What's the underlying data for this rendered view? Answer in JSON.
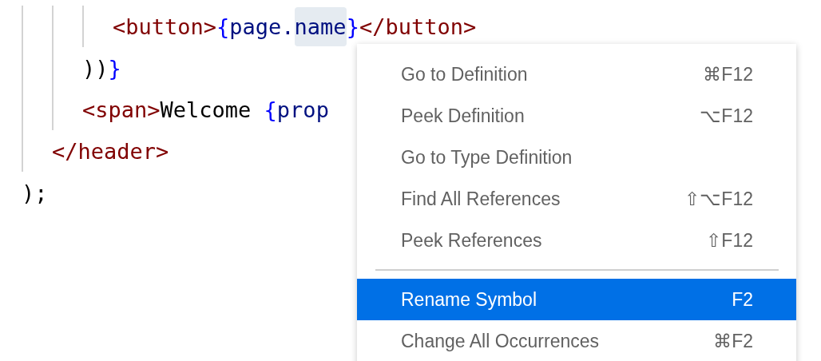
{
  "code": {
    "lines": [
      {
        "children": [
          {
            "children": [
              {
                "children": [
                  {
                    "tokens": [
                      {
                        "kind": "tag",
                        "text": "<button>"
                      },
                      {
                        "kind": "brace",
                        "text": "{"
                      },
                      {
                        "kind": "ident",
                        "text": "page."
                      },
                      {
                        "kind": "ident",
                        "text": "name",
                        "highlighted": true
                      },
                      {
                        "kind": "brace",
                        "text": "}"
                      },
                      {
                        "kind": "tag",
                        "text": "</button>"
                      }
                    ]
                  }
                ]
              },
              {
                "tokens": [
                  {
                    "kind": "plain",
                    "text": "))"
                  },
                  {
                    "kind": "brace",
                    "text": "}"
                  }
                ]
              },
              {
                "tokens": [
                  {
                    "kind": "tag",
                    "text": "<span>"
                  },
                  {
                    "kind": "plain",
                    "text": "Welcome "
                  },
                  {
                    "kind": "brace",
                    "text": "{"
                  },
                  {
                    "kind": "ident",
                    "text": "prop"
                  }
                ]
              }
            ]
          },
          {
            "tokens": [
              {
                "kind": "tag",
                "text": "</header>"
              }
            ]
          }
        ]
      },
      {
        "tokens": [
          {
            "kind": "plain",
            "text": ");"
          }
        ]
      }
    ]
  },
  "context_menu": {
    "items": [
      {
        "kind": "item",
        "label": "Go to Definition",
        "shortcut": "⌘F12",
        "selected": false
      },
      {
        "kind": "item",
        "label": "Peek Definition",
        "shortcut": "⌥F12",
        "selected": false
      },
      {
        "kind": "item",
        "label": "Go to Type Definition",
        "selected": false
      },
      {
        "kind": "item",
        "label": "Find All References",
        "shortcut": "⇧⌥F12",
        "selected": false
      },
      {
        "kind": "item",
        "label": "Peek References",
        "shortcut": "⇧F12",
        "selected": false
      },
      {
        "kind": "separator"
      },
      {
        "kind": "item",
        "label": "Rename Symbol",
        "shortcut": "F2",
        "selected": true
      },
      {
        "kind": "item",
        "label": "Change All Occurrences",
        "shortcut": "⌘F2",
        "selected": false
      }
    ]
  }
}
